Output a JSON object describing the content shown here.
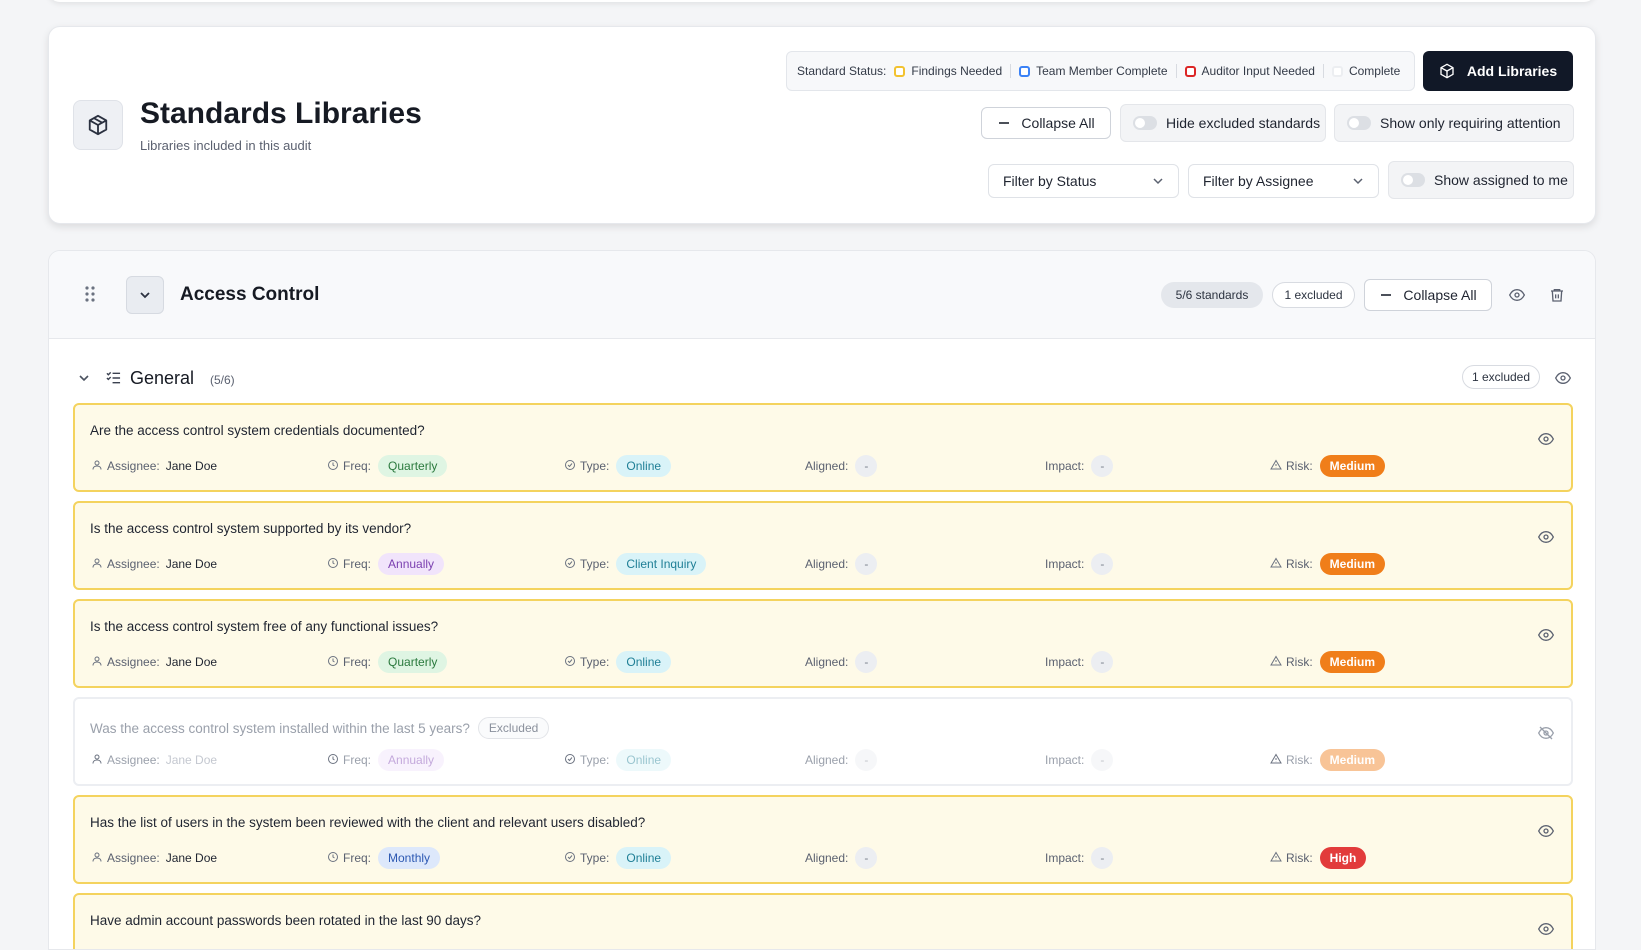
{
  "header": {
    "title": "Standards Libraries",
    "subtitle": "Libraries included in this audit",
    "legend": {
      "label": "Standard Status:",
      "items": [
        {
          "label": "Findings Needed",
          "color": "#f2c230"
        },
        {
          "label": "Team Member Complete",
          "color": "#3b82f6"
        },
        {
          "label": "Auditor Input Needed",
          "color": "#dc2626"
        },
        {
          "label": "Complete",
          "color": "#e5e7eb"
        }
      ]
    },
    "add_libraries_label": "Add Libraries",
    "collapse_all_label": "Collapse All",
    "hide_excluded_label": "Hide excluded standards",
    "show_attention_label": "Show only requiring attention",
    "filter_status_label": "Filter by Status",
    "filter_assignee_label": "Filter by Assignee",
    "show_assigned_label": "Show assigned to me"
  },
  "library": {
    "title": "Access Control",
    "standards_count": "5/6 standards",
    "excluded_count": "1 excluded",
    "collapse_all_label": "Collapse All",
    "section": {
      "title": "General",
      "count": "(5/6)",
      "excluded_count": "1 excluded"
    },
    "labels": {
      "assignee": "Assignee:",
      "freq": "Freq:",
      "type": "Type:",
      "aligned": "Aligned:",
      "impact": "Impact:",
      "risk": "Risk:",
      "excluded_tag": "Excluded"
    },
    "standards": [
      {
        "question": "Are the access control system credentials documented?",
        "assignee": "Jane Doe",
        "freq": "Quarterly",
        "type": "Online",
        "aligned": "-",
        "impact": "-",
        "risk": "Medium",
        "excluded": false
      },
      {
        "question": "Is the access control system supported by its vendor?",
        "assignee": "Jane Doe",
        "freq": "Annually",
        "type": "Client Inquiry",
        "aligned": "-",
        "impact": "-",
        "risk": "Medium",
        "excluded": false
      },
      {
        "question": "Is the access control system free of any functional issues?",
        "assignee": "Jane Doe",
        "freq": "Quarterly",
        "type": "Online",
        "aligned": "-",
        "impact": "-",
        "risk": "Medium",
        "excluded": false
      },
      {
        "question": "Was the access control system installed within the last 5 years?",
        "assignee": "Jane Doe",
        "freq": "Annually",
        "type": "Online",
        "aligned": "-",
        "impact": "-",
        "risk": "Medium",
        "excluded": true
      },
      {
        "question": "Has the list of users in the system been reviewed with the client and relevant users disabled?",
        "assignee": "Jane Doe",
        "freq": "Monthly",
        "type": "Online",
        "aligned": "-",
        "impact": "-",
        "risk": "High",
        "excluded": false
      },
      {
        "question": "Have admin account passwords been rotated in the last 90 days?",
        "assignee": "",
        "freq": "",
        "type": "",
        "aligned": "",
        "impact": "",
        "risk": "",
        "excluded": false
      }
    ]
  }
}
